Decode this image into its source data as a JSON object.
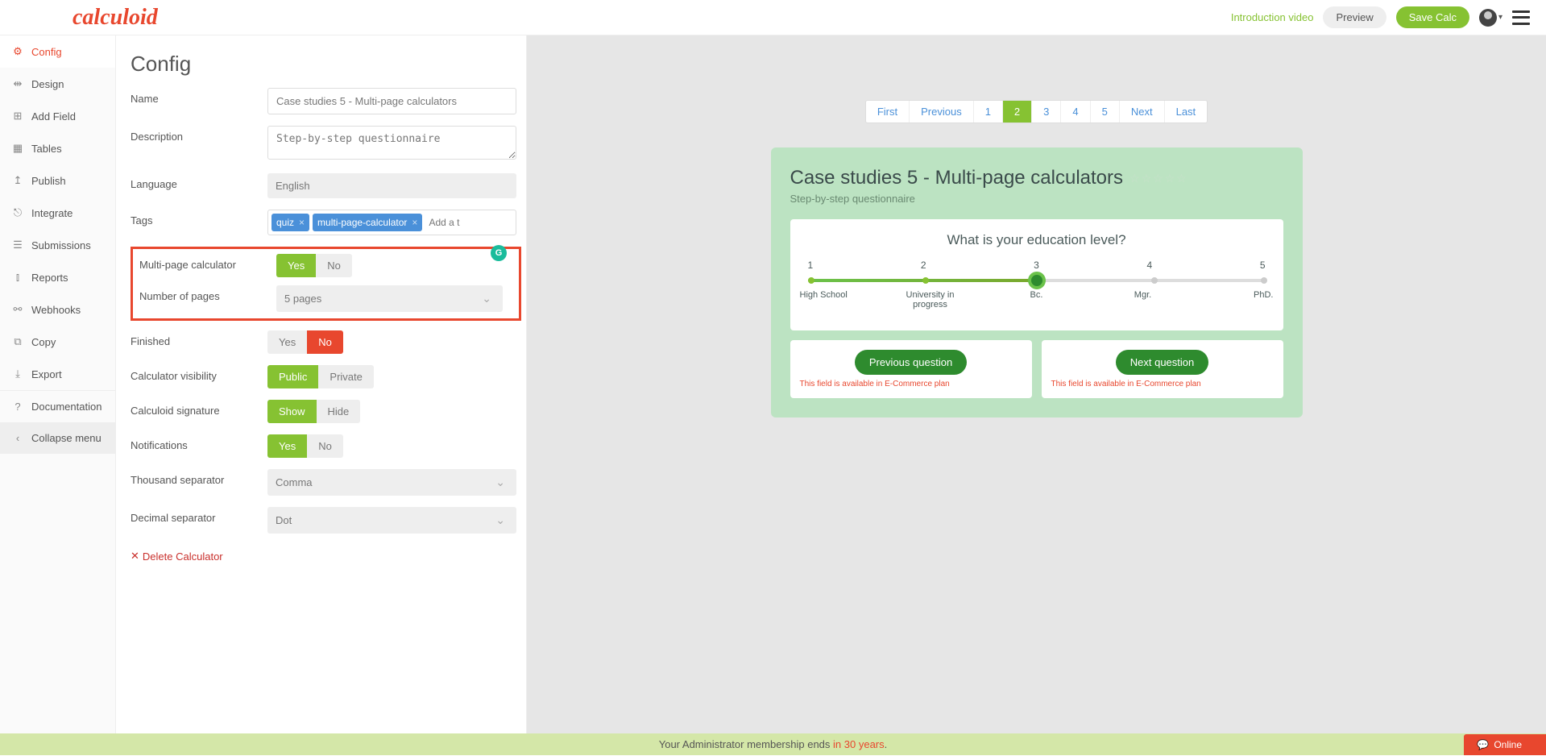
{
  "header": {
    "logo": "calculoid",
    "intro": "Introduction video",
    "preview": "Preview",
    "save": "Save Calc"
  },
  "sidebar": [
    {
      "icon": "⚙",
      "label": "Config",
      "active": true
    },
    {
      "icon": "⇹",
      "label": "Design"
    },
    {
      "icon": "⊞",
      "label": "Add Field"
    },
    {
      "icon": "▦",
      "label": "Tables"
    },
    {
      "icon": "↥",
      "label": "Publish"
    },
    {
      "icon": "⎋",
      "label": "Integrate"
    },
    {
      "icon": "☰",
      "label": "Submissions"
    },
    {
      "icon": "⫾",
      "label": "Reports"
    },
    {
      "icon": "⚯",
      "label": "Webhooks"
    },
    {
      "icon": "⧉",
      "label": "Copy"
    },
    {
      "icon": "⤓",
      "label": "Export"
    },
    {
      "icon": "?",
      "label": "Documentation",
      "doc": true
    },
    {
      "icon": "‹",
      "label": "Collapse menu",
      "collapse": true
    }
  ],
  "config": {
    "title": "Config",
    "name_label": "Name",
    "name_value": "Case studies 5 - Multi-page calculators",
    "desc_label": "Description",
    "desc_value": "Step-by-step questionnaire",
    "lang_label": "Language",
    "lang_value": "English",
    "tags_label": "Tags",
    "tags": [
      "quiz",
      "multi-page-calculator"
    ],
    "tag_placeholder": "Add a t",
    "multi_label": "Multi-page calculator",
    "multi_yes": "Yes",
    "multi_no": "No",
    "pages_label": "Number of pages",
    "pages_value": "5 pages",
    "finished_label": "Finished",
    "fin_yes": "Yes",
    "fin_no": "No",
    "vis_label": "Calculator visibility",
    "vis_pub": "Public",
    "vis_priv": "Private",
    "sig_label": "Calculoid signature",
    "sig_show": "Show",
    "sig_hide": "Hide",
    "notif_label": "Notifications",
    "not_yes": "Yes",
    "not_no": "No",
    "thou_label": "Thousand separator",
    "thou_value": "Comma",
    "dec_label": "Decimal separator",
    "dec_value": "Dot",
    "delete": "Delete Calculator"
  },
  "pager": [
    "First",
    "Previous",
    "1",
    "2",
    "3",
    "4",
    "5",
    "Next",
    "Last"
  ],
  "pager_active": "2",
  "preview": {
    "title": "Case studies 5 - Multi-page calculators",
    "sub": "Step-by-step questionnaire",
    "question": "What is your education level?",
    "nums": [
      "1",
      "2",
      "3",
      "4",
      "5"
    ],
    "labels": [
      "High School",
      "University in progress",
      "Bc.",
      "Mgr.",
      "PhD."
    ],
    "prev": "Previous question",
    "next": "Next question",
    "ecom": "This field is available in E-Commerce plan"
  },
  "footer": {
    "pre": "Your Administrator membership ends ",
    "years": "in 30 years",
    "dot": ".",
    "online": "Online"
  }
}
